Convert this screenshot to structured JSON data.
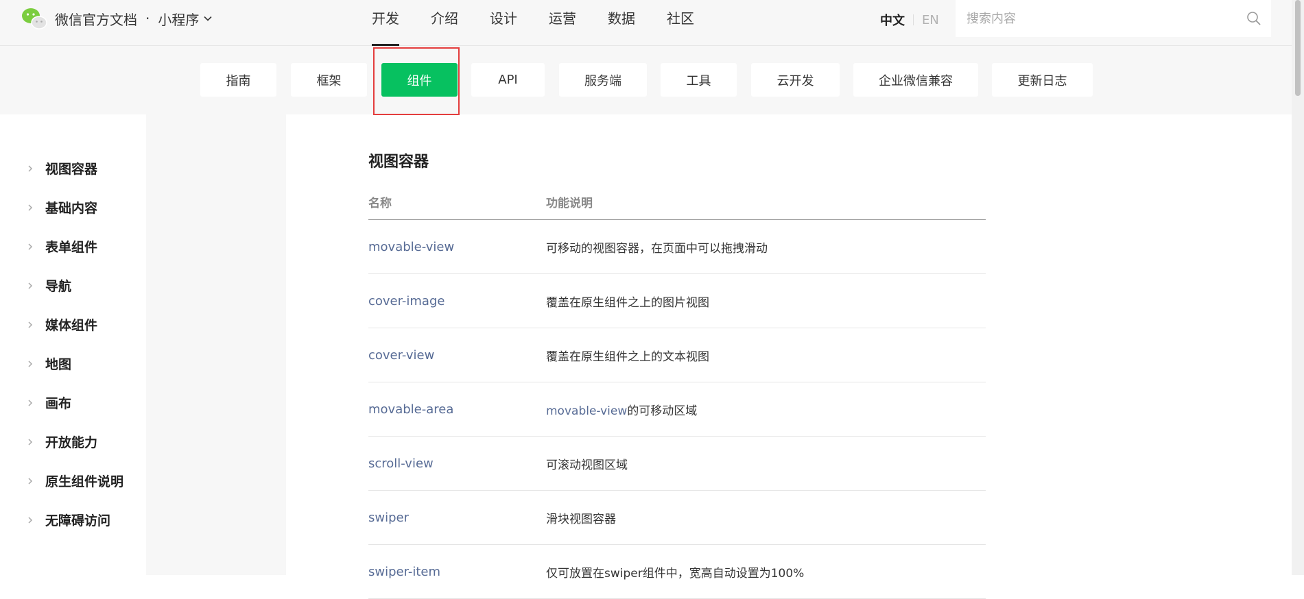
{
  "brand": {
    "title": "微信官方文档",
    "dot": "·",
    "product": "小程序"
  },
  "main_nav": [
    "开发",
    "介绍",
    "设计",
    "运营",
    "数据",
    "社区"
  ],
  "lang": {
    "zh": "中文",
    "en": "EN"
  },
  "search": {
    "placeholder": "搜索内容"
  },
  "sub_nav": [
    "指南",
    "框架",
    "组件",
    "API",
    "服务端",
    "工具",
    "云开发",
    "企业微信兼容",
    "更新日志"
  ],
  "sidebar": {
    "items": [
      "视图容器",
      "基础内容",
      "表单组件",
      "导航",
      "媒体组件",
      "地图",
      "画布",
      "开放能力",
      "原生组件说明",
      "无障碍访问"
    ]
  },
  "content": {
    "heading": "视图容器",
    "table": {
      "headers": [
        "名称",
        "功能说明"
      ],
      "rows": [
        {
          "name": "movable-view",
          "desc": "可移动的视图容器，在页面中可以拖拽滑动"
        },
        {
          "name": "cover-image",
          "desc": "覆盖在原生组件之上的图片视图"
        },
        {
          "name": "cover-view",
          "desc": "覆盖在原生组件之上的文本视图"
        },
        {
          "name": "movable-area",
          "desc_link": "movable-view",
          "desc": "的可移动区域"
        },
        {
          "name": "scroll-view",
          "desc": "可滚动视图区域"
        },
        {
          "name": "swiper",
          "desc": "滑块视图容器"
        },
        {
          "name": "swiper-item",
          "desc": "仅可放置在swiper组件中，宽高自动设置为100%"
        }
      ]
    }
  },
  "colors": {
    "accent_green": "#07c160",
    "link": "#576b95",
    "highlight": "#e43d3d"
  }
}
